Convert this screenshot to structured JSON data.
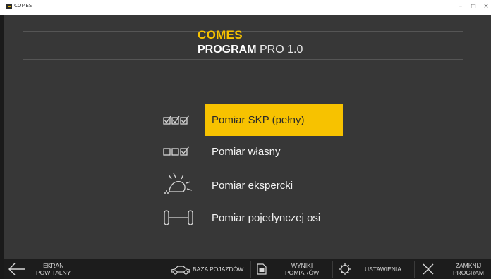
{
  "window": {
    "title": "COMES",
    "minimize_glyph": "–",
    "maximize_glyph": "□",
    "close_glyph": "×"
  },
  "brand": {
    "name": "COMES",
    "program_bold": "PROGRAM",
    "program_light": " PRO  1.0"
  },
  "menu": [
    {
      "label": "Pomiar SKP (pełny)",
      "icon": "three-checkboxes-checked-icon",
      "active": true
    },
    {
      "label": "Pomiar własny",
      "icon": "checkboxes-one-checked-icon",
      "active": false
    },
    {
      "label": "Pomiar ekspercki",
      "icon": "headlight-beam-icon",
      "active": false
    },
    {
      "label": "Pomiar pojedynczej osi",
      "icon": "axle-icon",
      "active": false
    }
  ],
  "toolbar": {
    "back_line1": "EKRAN",
    "back_line2": "POWITALNY",
    "vehicles": "BAZA POJAZDÓW",
    "results_line1": "WYNIKI",
    "results_line2": "POMIARÓW",
    "settings": "USTAWIENIA",
    "close_line1": "ZAMKNIJ",
    "close_line2": "PROGRAM"
  },
  "colors": {
    "accent": "#f7c200",
    "background": "#373737",
    "toolbar": "#1c1c1c"
  }
}
